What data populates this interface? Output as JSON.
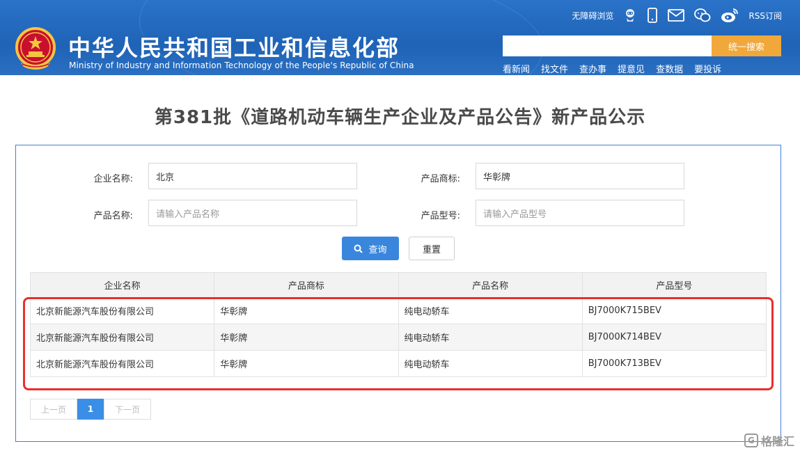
{
  "header": {
    "title": "中华人民共和国工业和信息化部",
    "subtitle": "Ministry of Industry and Information Technology of the People's Republic of China",
    "accessibility_link": "无障碍浏览",
    "rss_link": "RSS订阅",
    "search": {
      "value": "",
      "placeholder": "",
      "button": "统一搜索"
    },
    "nav": [
      "看新闻",
      "找文件",
      "查办事",
      "提意见",
      "查数据",
      "要投诉"
    ],
    "colors": {
      "banner": "#1f63b6",
      "search_button": "#f1a83b"
    }
  },
  "page_title": "第381批《道路机动车辆生产企业及产品公告》新产品公示",
  "form": {
    "company_label": "企业名称:",
    "company_value": "北京",
    "brand_label": "产品商标:",
    "brand_value": "华彰牌",
    "product_label": "产品名称:",
    "product_placeholder": "请输入产品名称",
    "model_label": "产品型号:",
    "model_placeholder": "请输入产品型号",
    "query_button": "查询",
    "reset_button": "重置"
  },
  "table": {
    "headers": [
      "企业名称",
      "产品商标",
      "产品名称",
      "产品型号"
    ],
    "rows": [
      [
        "北京新能源汽车股份有限公司",
        "华彰牌",
        "纯电动轿车",
        "BJ7000K715BEV"
      ],
      [
        "北京新能源汽车股份有限公司",
        "华彰牌",
        "纯电动轿车",
        "BJ7000K714BEV"
      ],
      [
        "北京新能源汽车股份有限公司",
        "华彰牌",
        "纯电动轿车",
        "BJ7000K713BEV"
      ]
    ],
    "highlight_color": "#e8302b"
  },
  "pagination": {
    "prev": "上一页",
    "current": "1",
    "next": "下一页"
  },
  "watermark": {
    "text": "格隆汇"
  }
}
